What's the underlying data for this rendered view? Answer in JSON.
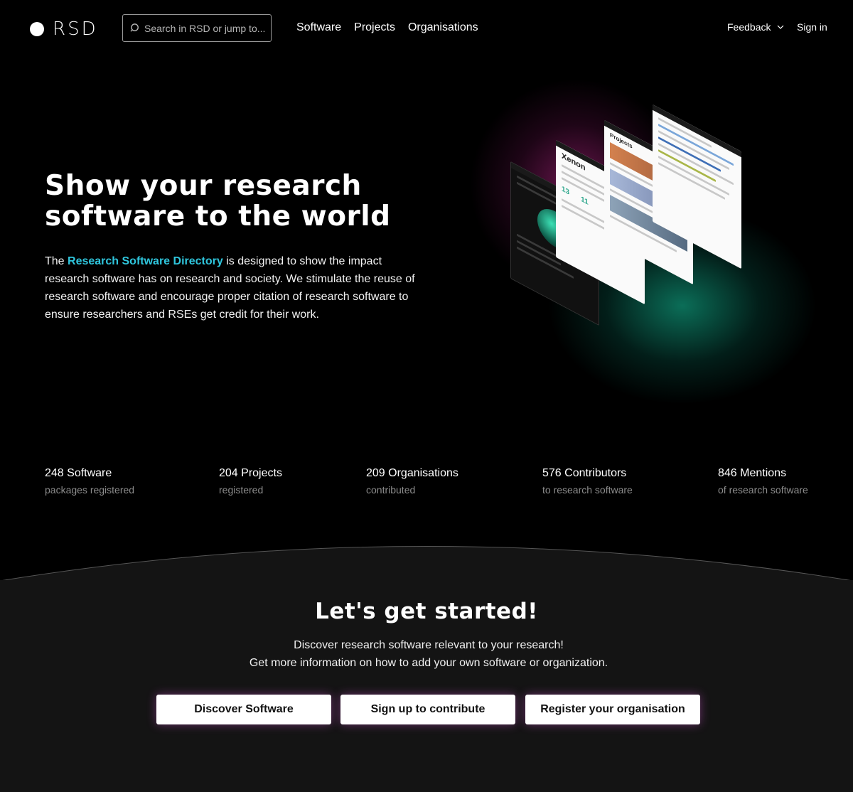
{
  "header": {
    "logo_text": "RSD",
    "search_placeholder": "Search in RSD or jump to...",
    "nav": [
      "Software",
      "Projects",
      "Organisations"
    ],
    "feedback_label": "Feedback",
    "signin_label": "Sign in"
  },
  "hero": {
    "title_line1": "Show your research",
    "title_line2": "software to the world",
    "text_prefix": "The ",
    "text_highlight": "Research Software Directory",
    "text_rest": " is designed to show the impact research software has on research and society. We stimulate the reuse of research software and encourage proper citation of research software to ensure researchers and RSEs get credit for their work.",
    "highlight_color": "#2fc6dd"
  },
  "stats": [
    {
      "value": "248 Software",
      "label": "packages registered"
    },
    {
      "value": "204 Projects",
      "label": "registered"
    },
    {
      "value": "209 Organisations",
      "label": "contributed"
    },
    {
      "value": "576 Contributors",
      "label": "to research software"
    },
    {
      "value": "846 Mentions",
      "label": "of research software"
    }
  ],
  "get_started": {
    "title": "Let's get started!",
    "line1": "Discover research software relevant to your research!",
    "line2": "Get more information on how to add your own software or organization.",
    "buttons": [
      "Discover Software",
      "Sign up to contribute",
      "Register your organisation"
    ]
  },
  "illustration": {
    "panel_titles": [
      "Xenon",
      "Projects"
    ],
    "numbers": [
      "13",
      "11"
    ]
  }
}
